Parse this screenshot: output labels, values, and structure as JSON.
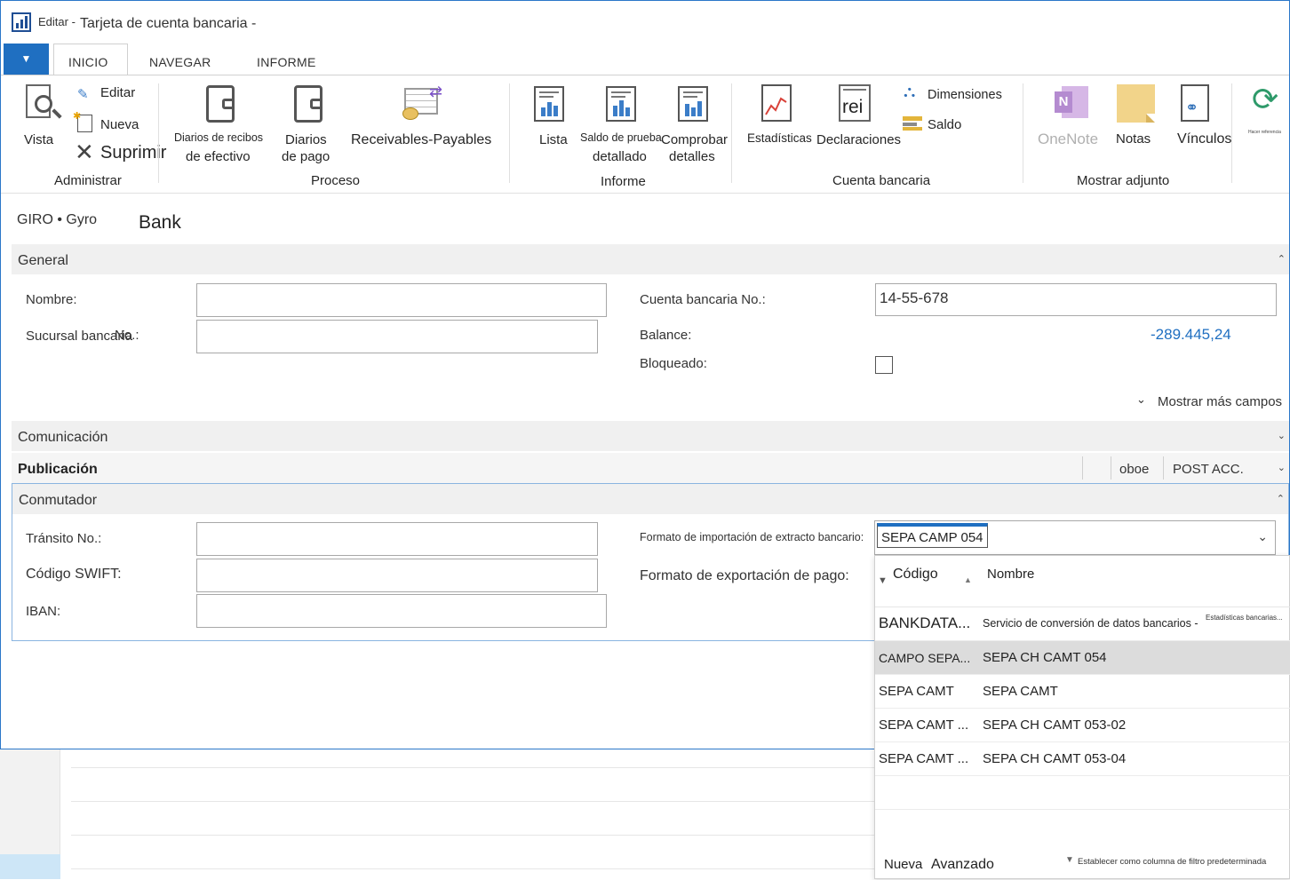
{
  "window": {
    "edit_label": "Editar -",
    "title": "Tarjeta de cuenta bancaria -"
  },
  "ribbon": {
    "menu_arrow": "▼",
    "tabs": [
      "INICIO",
      "NAVEGAR",
      "INFORME"
    ],
    "active_tab": "INICIO",
    "administrar": {
      "vista": "Vista",
      "editar": "Editar",
      "nueva": "Nueva",
      "suprimir": "Suprimir",
      "group": "Administrar"
    },
    "proceso": {
      "diarios_recibos_1": "Diarios de recibos",
      "diarios_recibos_2": "de efectivo",
      "diarios_pago_1": "Diarios",
      "diarios_pago_2": "de pago",
      "receivables": "Receivables-Payables",
      "group": "Proceso"
    },
    "informe": {
      "lista": "Lista",
      "saldo_1": "Saldo de prueba",
      "saldo_2": "detallado",
      "comprobar_1": "Comprobar",
      "comprobar_2": "detalles",
      "group": "Informe"
    },
    "cuenta": {
      "estadisticas": "Estadísticas",
      "rei": "rei",
      "declaraciones": "Declaraciones",
      "dimensiones": "Dimensiones",
      "saldo": "Saldo",
      "group": "Cuenta bancaria"
    },
    "adjunto": {
      "onenote": "OneNote",
      "notas": "Notas",
      "vinculos": "Vínculos",
      "group": "Mostrar adjunto"
    },
    "refresh_caption": "Hacer referencia"
  },
  "record": {
    "breadcrumb": "GIRO • Gyro",
    "name": "Bank"
  },
  "general": {
    "title": "General",
    "nombre_label": "Nombre:",
    "nombre_value": "",
    "sucursal_label": "Sucursal bancaria",
    "sucursal_overlap": "No.:",
    "sucursal_value": "",
    "cuenta_label": "Cuenta bancaria No.:",
    "cuenta_value": "14-55-678",
    "balance_label": "Balance:",
    "balance_value": "-289.445,24",
    "bloqueado_label": "Bloqueado:",
    "bloqueado_checked": false,
    "mostrar_mas": "Mostrar más campos"
  },
  "comunicacion": {
    "title": "Comunicación"
  },
  "publicacion": {
    "title": "Publicación",
    "summary_1": "oboe",
    "summary_2": "POST ACC."
  },
  "conmutador": {
    "title": "Conmutador",
    "transito_label": "Tránsito No.:",
    "swift_label": "Código SWIFT:",
    "iban_label": "IBAN:",
    "import_label": "Formato de importación de extracto bancario:",
    "import_value": "SEPA CAMP 054",
    "export_label": "Formato de exportación de pago:"
  },
  "dropdown": {
    "col_code": "Código",
    "col_name": "Nombre",
    "rows": [
      {
        "code": "BANKDATA...",
        "name": "Servicio de conversión de datos bancarios -",
        "extra": "Estadísticas bancarias..."
      },
      {
        "code": "CAMPO SEPA...",
        "name": "SEPA CH CAMT 054",
        "extra": ""
      },
      {
        "code": "SEPA CAMT",
        "name": "SEPA CAMT",
        "extra": ""
      },
      {
        "code": "SEPA CAMT ...",
        "name": "SEPA CH CAMT 053-02",
        "extra": ""
      },
      {
        "code": "SEPA CAMT ...",
        "name": "SEPA CH CAMT 053-04",
        "extra": ""
      }
    ],
    "footer_new": "Nueva",
    "footer_adv": "Avanzado",
    "footer_filter": "Establecer como columna de filtro predeterminada"
  }
}
